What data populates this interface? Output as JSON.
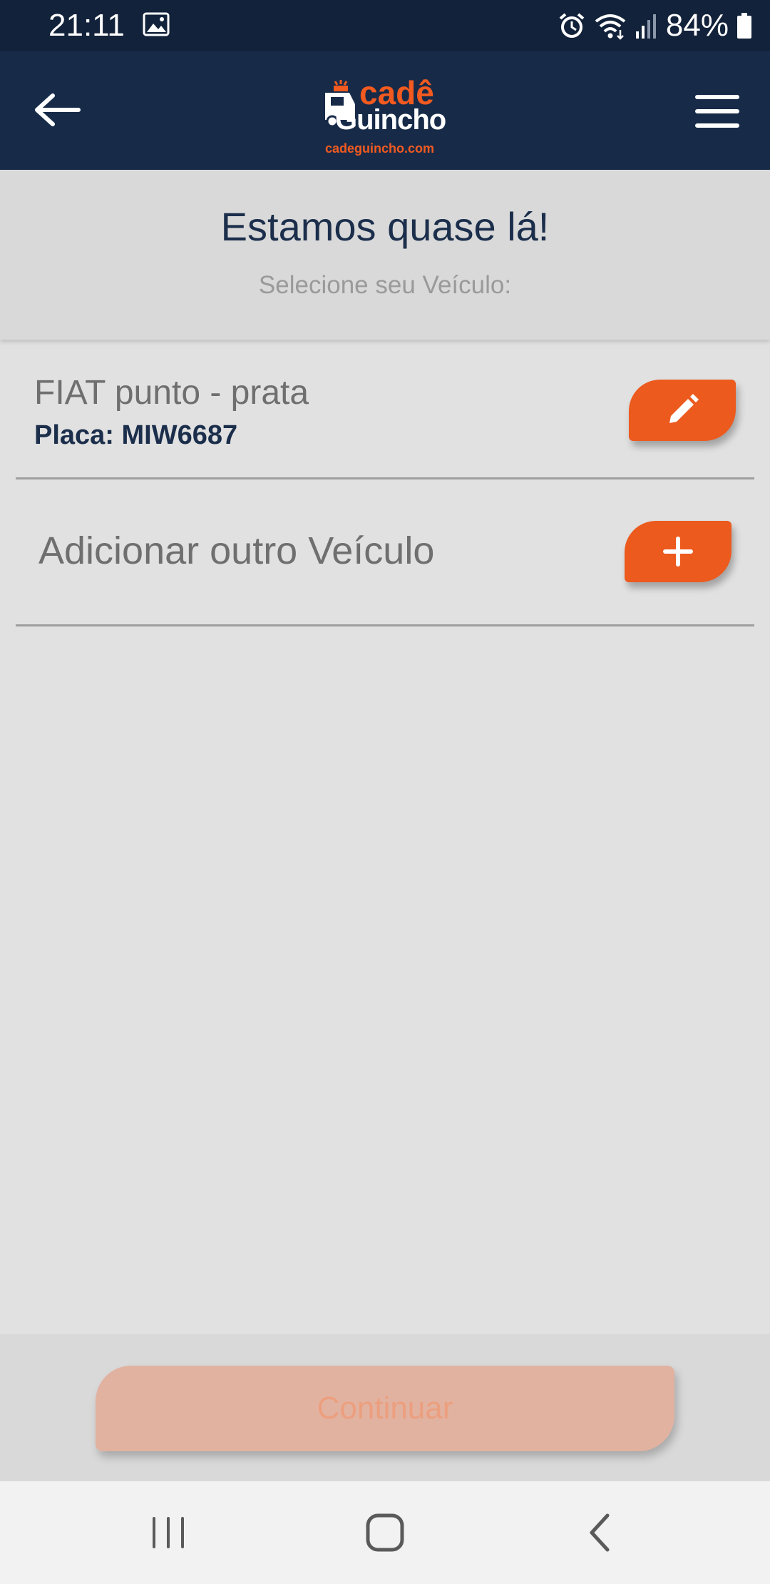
{
  "status_bar": {
    "time": "21:11",
    "battery": "84%",
    "icons": [
      "gallery-icon",
      "alarm-icon",
      "wifi-icon",
      "signal-icon",
      "battery-icon"
    ]
  },
  "header": {
    "logo": {
      "line1": "cadê",
      "line2": "Guincho",
      "url": "cadeguincho.com"
    },
    "back_icon": "arrow-left-icon",
    "menu_icon": "hamburger-menu-icon"
  },
  "title_section": {
    "title": "Estamos quase lá!",
    "subtitle": "Selecione seu Veículo:"
  },
  "vehicles": [
    {
      "name": "FIAT punto - prata",
      "plate": "Placa: MIW6687",
      "action_icon": "pencil-icon"
    }
  ],
  "add_vehicle": {
    "label": "Adicionar outro Veículo",
    "action_icon": "plus-icon"
  },
  "footer": {
    "continue_label": "Continuar"
  },
  "colors": {
    "header_bg": "#172b49",
    "status_bg": "#12223a",
    "accent": "#ec5a1e",
    "disabled_button": "#e2b2a1",
    "title_text": "#1b2e4b"
  },
  "nav_bar": {
    "icons": [
      "recent-apps-icon",
      "home-icon",
      "back-icon"
    ]
  }
}
